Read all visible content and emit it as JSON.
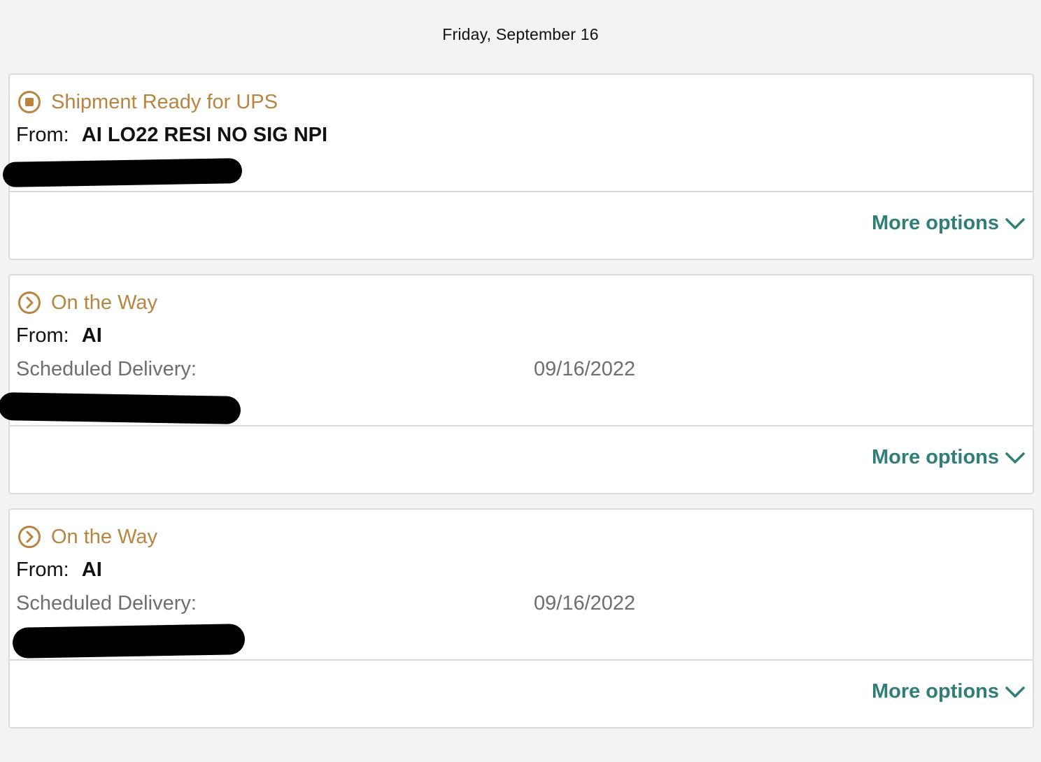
{
  "header": {
    "date": "Friday, September 16"
  },
  "colors": {
    "status": "#b88440",
    "link": "#2f7f78",
    "background": "#f4f3f3"
  },
  "shipments": [
    {
      "status_icon": "stop-circle-icon",
      "status": "Shipment Ready for UPS",
      "from_label": "From:",
      "from_value": "AI LO22 RESI NO SIG NPI",
      "more_options": "More options"
    },
    {
      "status_icon": "chevron-right-circle-icon",
      "status": "On the Way",
      "from_label": "From:",
      "from_value": "AI",
      "scheduled_label": "Scheduled Delivery:",
      "scheduled_date": "09/16/2022",
      "more_options": "More options"
    },
    {
      "status_icon": "chevron-right-circle-icon",
      "status": "On the Way",
      "from_label": "From:",
      "from_value": "AI",
      "scheduled_label": "Scheduled Delivery:",
      "scheduled_date": "09/16/2022",
      "more_options": "More options"
    }
  ]
}
